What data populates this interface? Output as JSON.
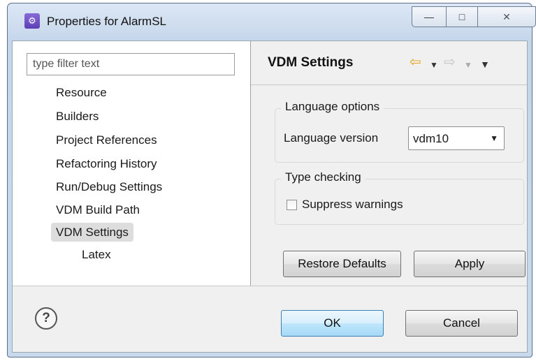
{
  "window": {
    "title": "Properties for AlarmSL",
    "app_icon": "eclipse-properties-icon",
    "controls": {
      "minimize": "—",
      "maximize": "□",
      "close": "✕"
    }
  },
  "left_panel": {
    "filter_placeholder": "type filter text",
    "filter_value": "",
    "tree": [
      {
        "label": "Resource",
        "selected": false,
        "indent": 0
      },
      {
        "label": "Builders",
        "selected": false,
        "indent": 0
      },
      {
        "label": "Project References",
        "selected": false,
        "indent": 0
      },
      {
        "label": "Refactoring History",
        "selected": false,
        "indent": 0
      },
      {
        "label": "Run/Debug Settings",
        "selected": false,
        "indent": 0
      },
      {
        "label": "VDM Build Path",
        "selected": false,
        "indent": 0
      },
      {
        "label": "VDM Settings",
        "selected": true,
        "indent": 0
      },
      {
        "label": "Latex",
        "selected": false,
        "indent": 1
      }
    ]
  },
  "right_panel": {
    "title": "VDM Settings",
    "nav": {
      "back": "⇦",
      "back_menu": "▼",
      "forward": "⇨",
      "forward_menu": "▼",
      "view_menu": "▼"
    },
    "language_group": {
      "legend": "Language options",
      "version_label": "Language version",
      "version_value": "vdm10",
      "dropdown_arrow": "▼"
    },
    "typecheck_group": {
      "legend": "Type checking",
      "suppress_label": "Suppress warnings",
      "suppress_checked": false
    },
    "restore_defaults": "Restore Defaults",
    "apply": "Apply"
  },
  "footer": {
    "help": "?",
    "ok": "OK",
    "cancel": "Cancel"
  },
  "colors": {
    "accent_back_arrow": "#e3a21a",
    "ok_button": "#bee6fd",
    "selected_item": "#dddddd"
  }
}
